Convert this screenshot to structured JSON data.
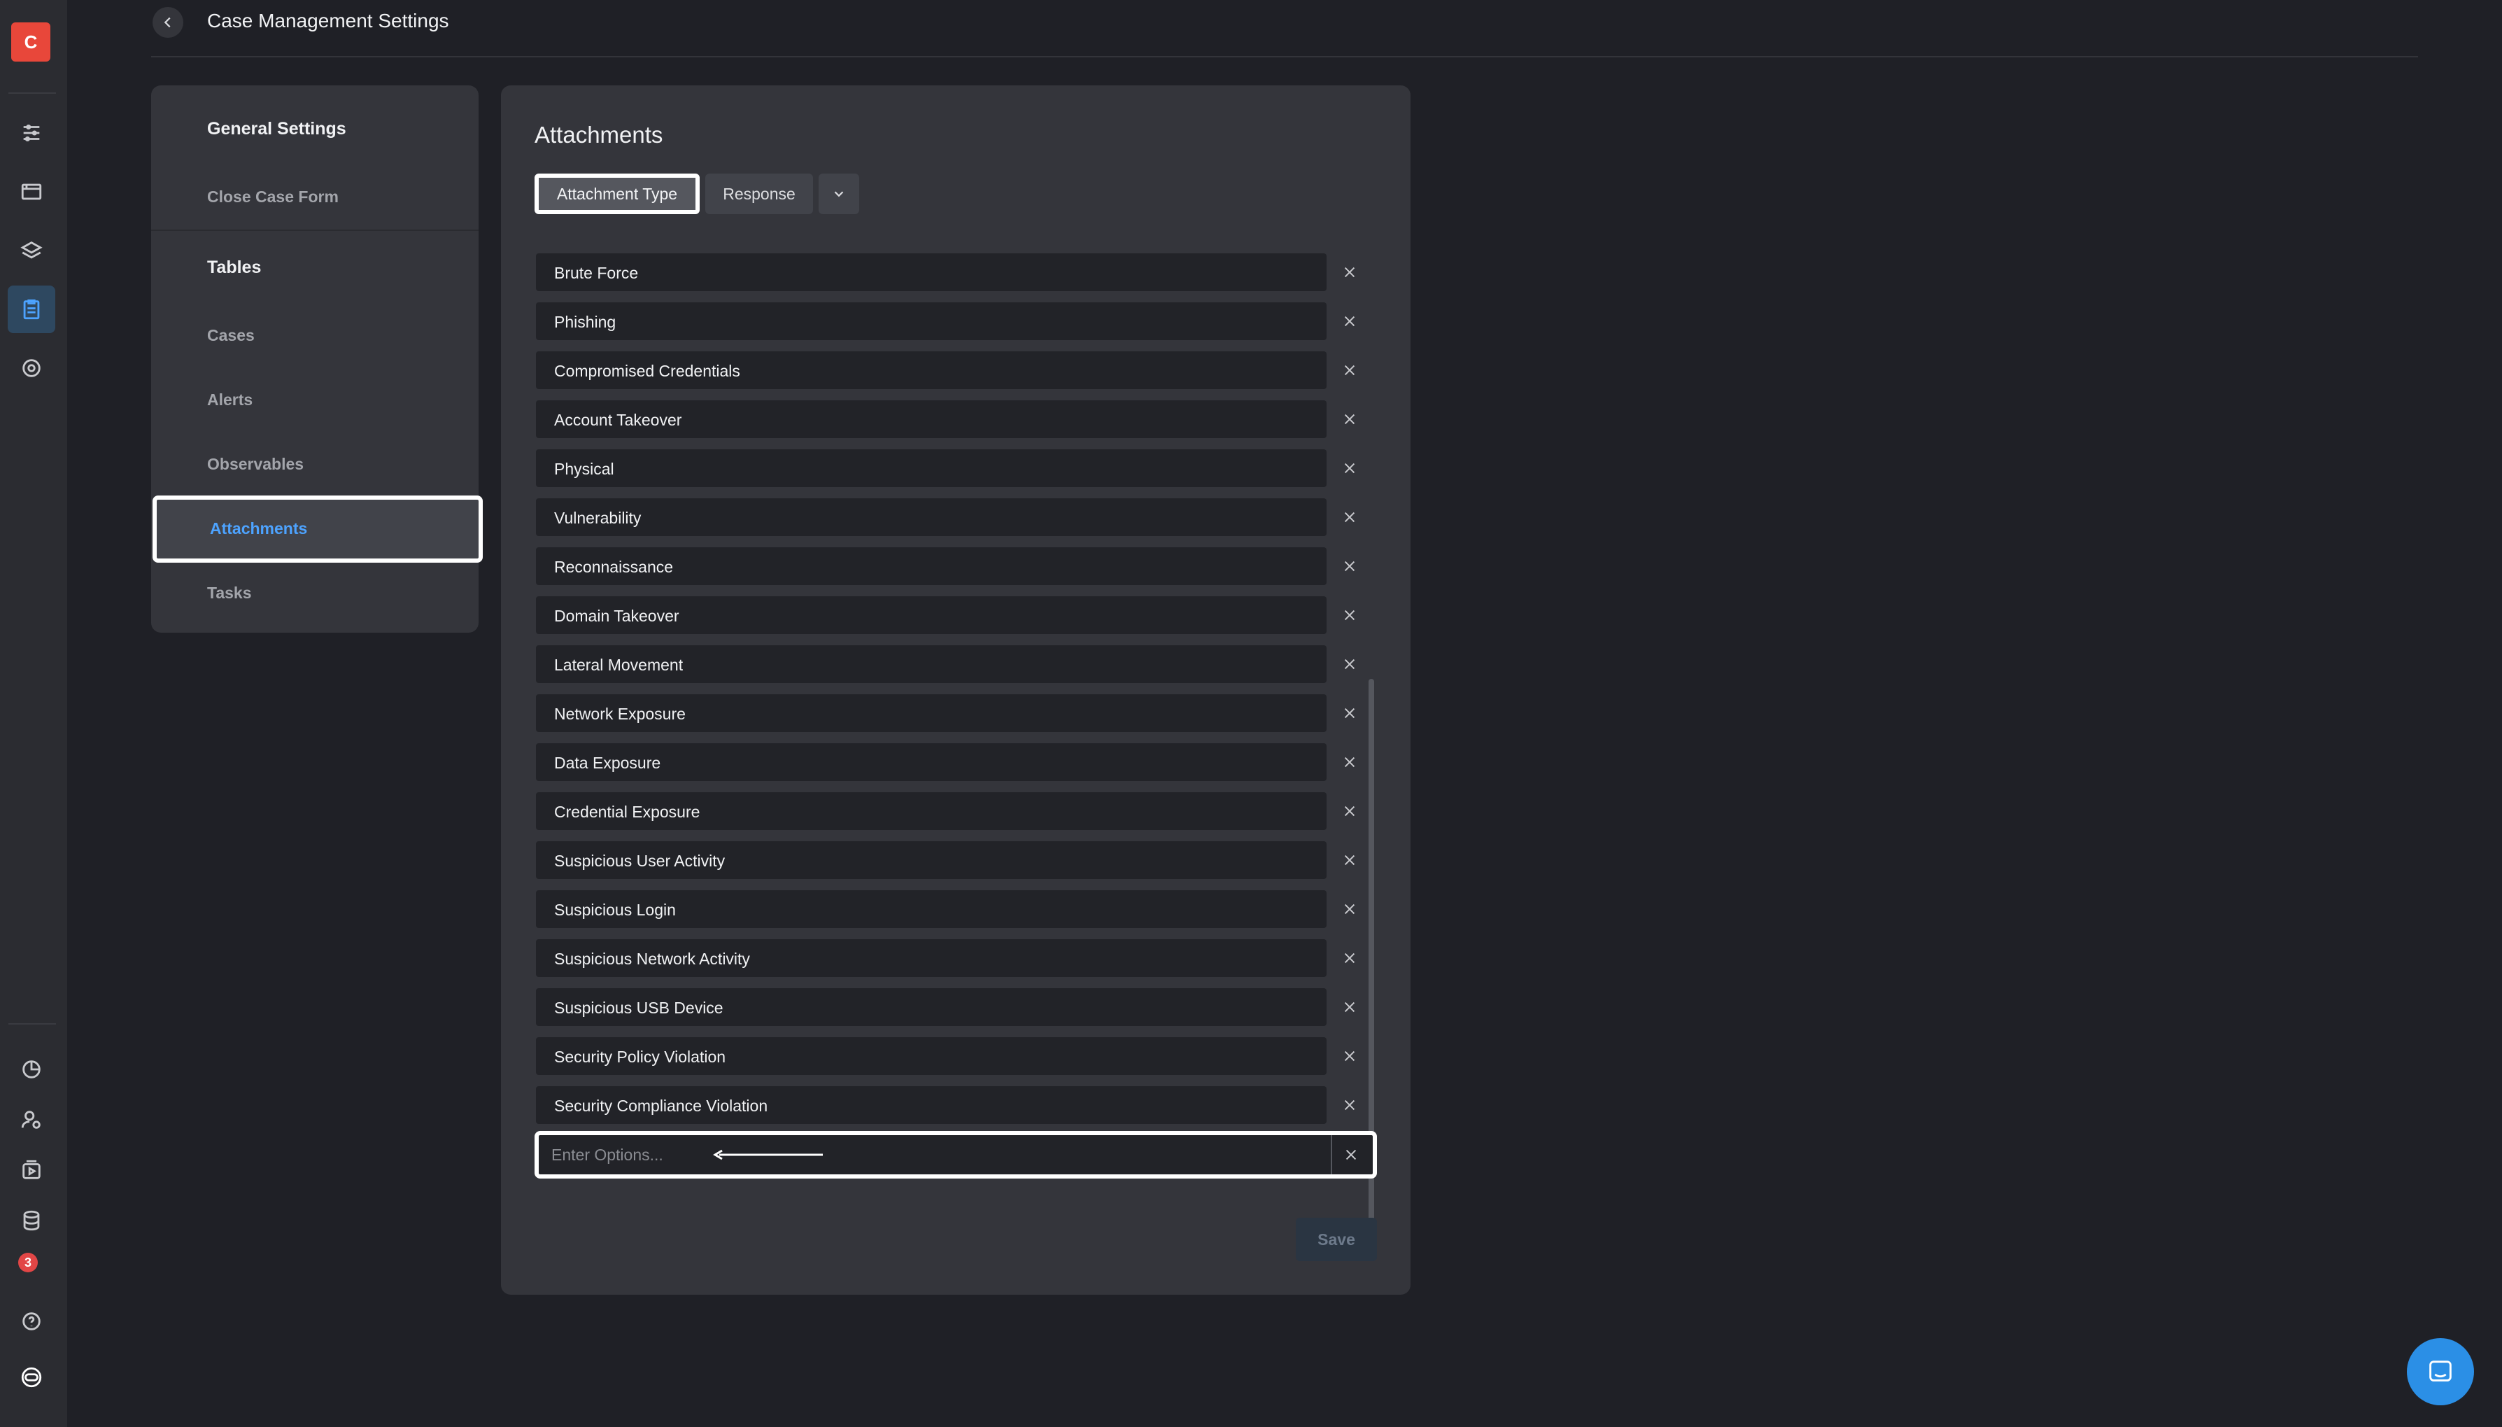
{
  "app": {
    "logo_letter": "C",
    "notification_count": "3",
    "colors": {
      "accent": "#4da3ff",
      "logo": "#e8473a",
      "badge": "#e24646"
    }
  },
  "header": {
    "title": "Case Management Settings"
  },
  "nav": {
    "general_heading": "General Settings",
    "close_case_form": "Close Case Form",
    "tables_heading": "Tables",
    "items": [
      "Cases",
      "Alerts",
      "Observables",
      "Attachments",
      "Tasks"
    ],
    "active_item": "Attachments"
  },
  "panel": {
    "title": "Attachments",
    "tabs": [
      "Attachment Type",
      "Response"
    ],
    "selected_tab": "Attachment Type",
    "options": [
      "Brute Force",
      "Phishing",
      "Compromised Credentials",
      "Account Takeover",
      "Physical",
      "Vulnerability",
      "Reconnaissance",
      "Domain Takeover",
      "Lateral Movement",
      "Network Exposure",
      "Data Exposure",
      "Credential Exposure",
      "Suspicious User Activity",
      "Suspicious Login",
      "Suspicious Network Activity",
      "Suspicious USB Device",
      "Security Policy Violation",
      "Security Compliance Violation"
    ],
    "new_option_placeholder": "Enter Options...",
    "new_option_value": "",
    "save_label": "Save"
  }
}
